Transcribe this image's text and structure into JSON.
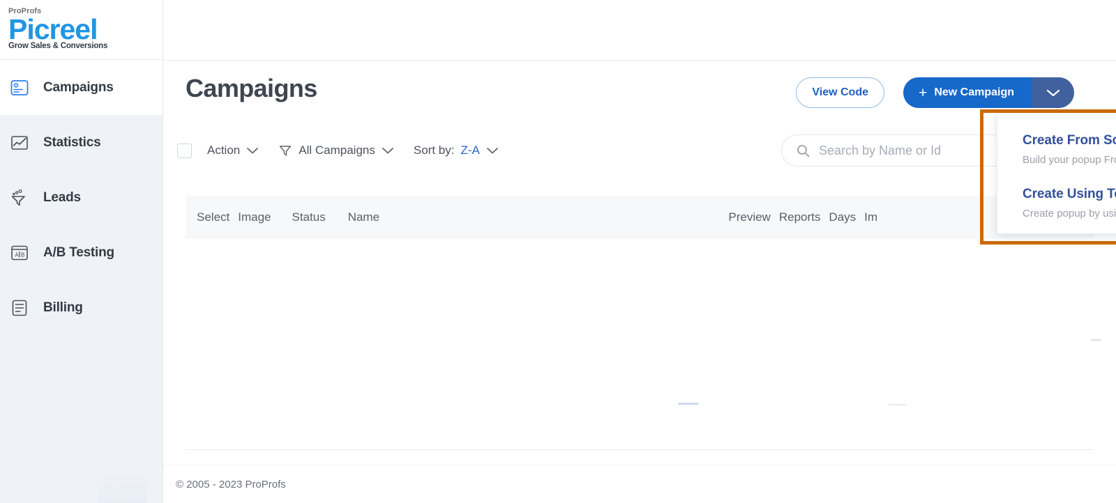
{
  "brand": {
    "proprofs": "ProProfs",
    "name": "Picreel",
    "tagline": "Grow Sales & Conversions",
    "logo_color": "#2196e3"
  },
  "sidebar": {
    "items": [
      {
        "label": "Campaigns",
        "icon": "campaigns-icon",
        "active": true
      },
      {
        "label": "Statistics",
        "icon": "statistics-icon",
        "active": false
      },
      {
        "label": "Leads",
        "icon": "leads-funnel-icon",
        "active": false
      },
      {
        "label": "A/B Testing",
        "icon": "ab-testing-icon",
        "active": false
      },
      {
        "label": "Billing",
        "icon": "billing-icon",
        "active": false
      }
    ]
  },
  "header": {
    "title": "Campaigns",
    "view_code_label": "View Code",
    "new_campaign_label": "New Campaign",
    "new_campaign_plus": "+",
    "caret_icon": "chevron-down-icon",
    "primary_color": "#1668c9",
    "caret_color": "#41619e",
    "outline_color": "#8bb8e8"
  },
  "toolbar": {
    "checkbox_checked": false,
    "action_label": "Action",
    "filter_icon": "funnel-icon",
    "filter_label": "All Campaigns",
    "sort_prefix": "Sort by:",
    "sort_value": "Z-A",
    "chevron_icon": "chevron-down-icon"
  },
  "search": {
    "icon": "search-icon",
    "placeholder": "Search by Name or Id",
    "value": ""
  },
  "table": {
    "columns_left": [
      "Select",
      "Image",
      "Status",
      "Name"
    ],
    "columns_right": [
      "Preview",
      "Reports",
      "Days",
      "Im"
    ],
    "rows": []
  },
  "dropdown": {
    "highlight_color": "#cb6a0a",
    "items": [
      {
        "title": "Create From Scratch",
        "subtitle": "Build your popup From Scretch"
      },
      {
        "title": "Create Using Templates",
        "subtitle": "Create popup by using template"
      }
    ]
  },
  "footer": {
    "copyright": "© 2005 - 2023 ProProfs"
  }
}
